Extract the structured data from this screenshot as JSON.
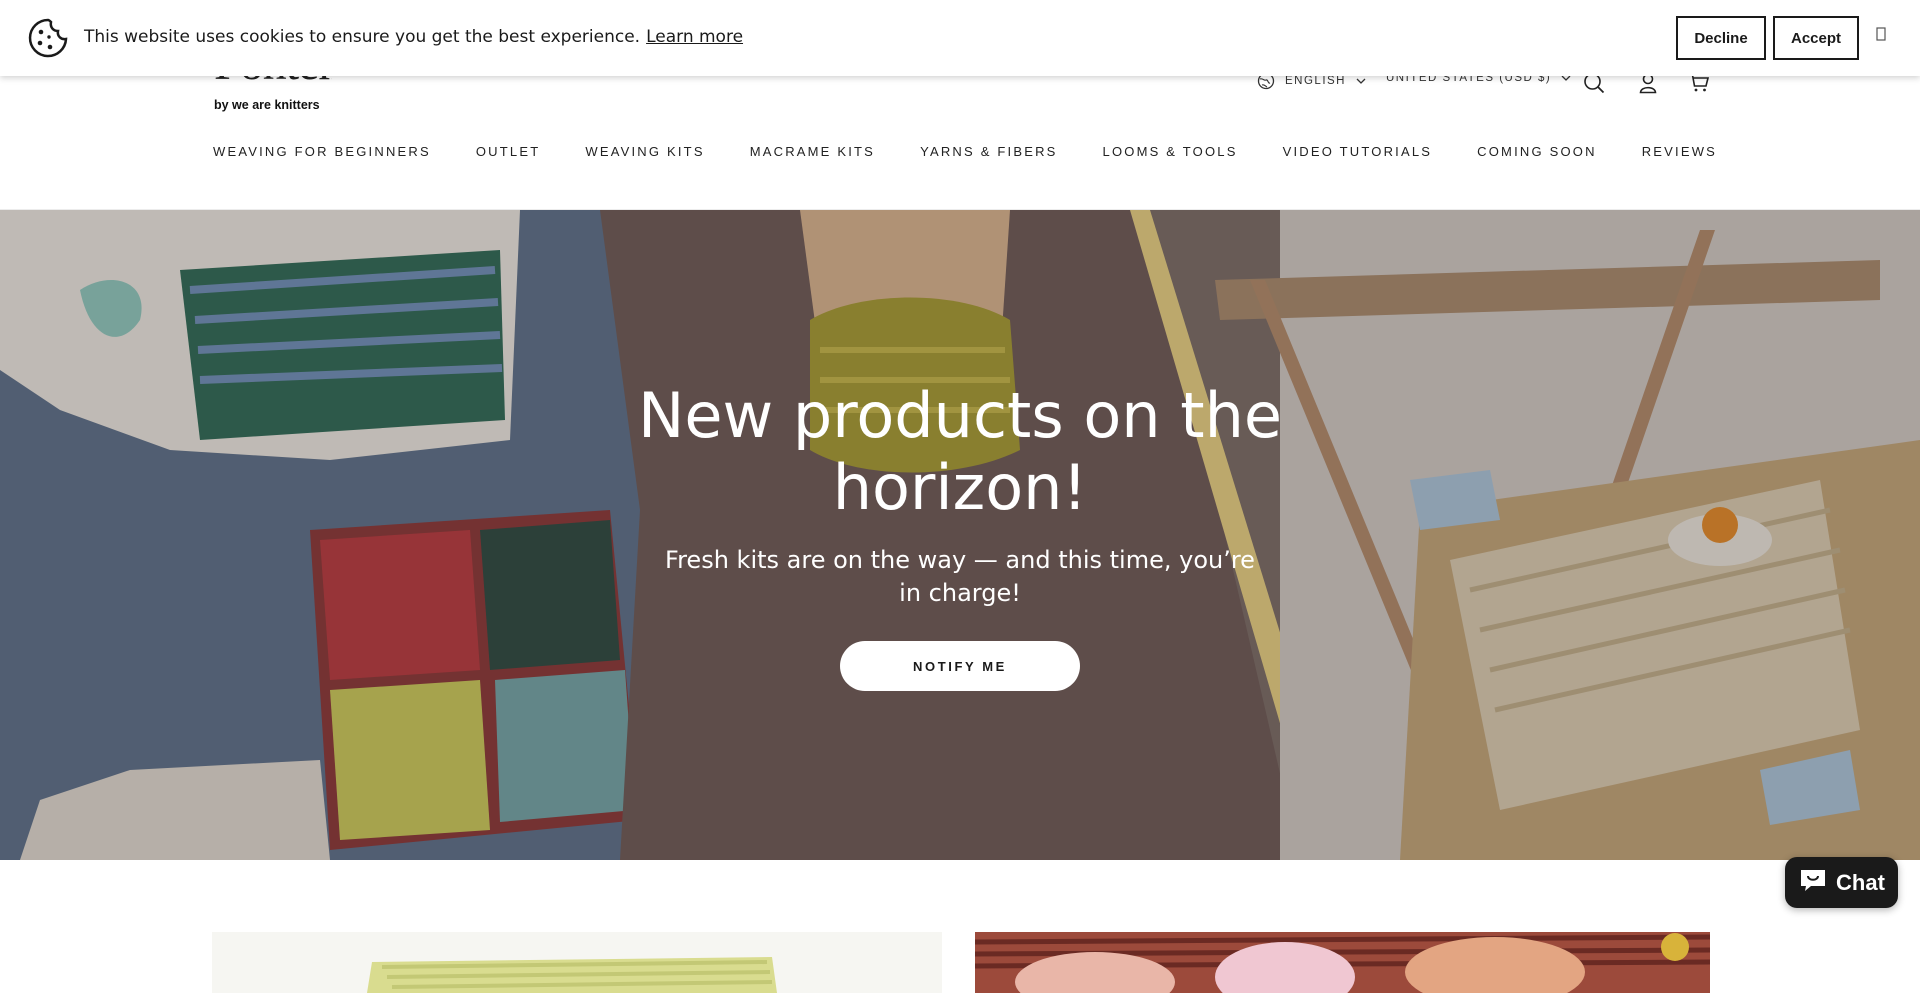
{
  "cookie_banner": {
    "message": "This website uses cookies to ensure you get the best experience.",
    "learn_more": "Learn more",
    "decline": "Decline",
    "accept": "Accept",
    "close_icon": "close-icon"
  },
  "header": {
    "logo_main": "Fontem",
    "logo_sub": "by we are knitters",
    "language": "ENGLISH",
    "country": "UNITED STATES (USD $)",
    "icons": [
      "globe-icon",
      "search-icon",
      "account-icon",
      "cart-icon"
    ]
  },
  "nav": {
    "items": [
      "WEAVING FOR BEGINNERS",
      "OUTLET",
      "WEAVING KITS",
      "MACRAME KITS",
      "YARNS & FIBERS",
      "LOOMS & TOOLS",
      "VIDEO TUTORIALS",
      "COMING SOON",
      "REVIEWS"
    ]
  },
  "hero": {
    "title": "New products on the horizon!",
    "subtitle": "Fresh kits are on the way — and this time, you’re in charge!",
    "cta": "NOTIFY ME"
  },
  "chat": {
    "label": "Chat"
  },
  "colors": {
    "primary_text": "#1a1a1a",
    "hero_text": "#ffffff",
    "button_bg": "#ffffff",
    "chat_bg": "#1a1a1a"
  }
}
